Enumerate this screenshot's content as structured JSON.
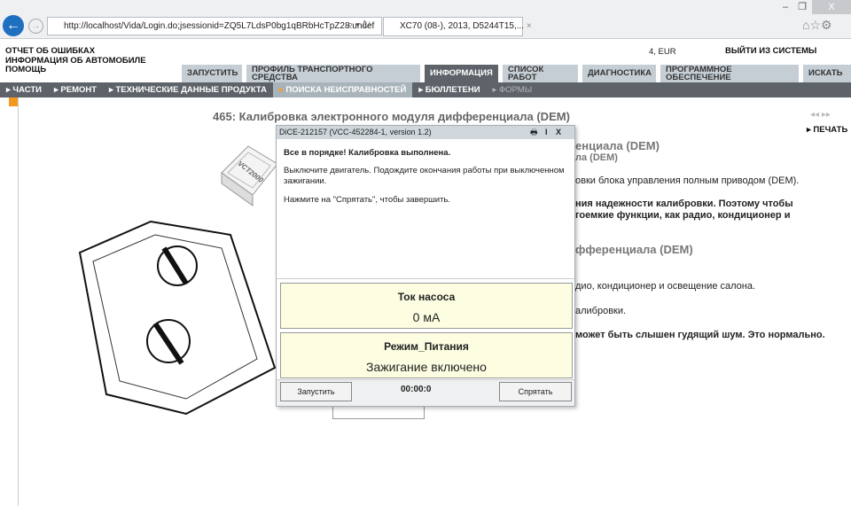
{
  "browser": {
    "url": "http://localhost/Vida/Login.do;jsessionid=ZQ5L7LdsP0bg1qBRbHcTpZ28.undef",
    "tab_title": "XC70 (08-), 2013, D5244T15,...",
    "tab_close": "×",
    "minimize": "–",
    "restore": "❐",
    "close": "X"
  },
  "header": {
    "links": [
      "ОТЧЕТ ОБ ОШИБКАХ",
      "ИНФОРМАЦИЯ ОБ АВТОМОБИЛЕ",
      "ПОМОЩЬ"
    ],
    "currency": "4, EUR",
    "logout": "ВЫЙТИ ИЗ СИСТЕМЫ"
  },
  "tabs": [
    "ЗАПУСТИТЬ",
    "ПРОФИЛЬ ТРАНСПОРТНОГО СРЕДСТВА",
    "ИНФОРМАЦИЯ",
    "СПИСОК РАБОТ",
    "ДИАГНОСТИКА",
    "ПРОГРАММНОЕ ОБЕСПЕЧЕНИЕ",
    "ИСКАТЬ"
  ],
  "subnav": [
    "ЧАСТИ",
    "РЕМОНТ",
    "ТЕХНИЧЕСКИЕ ДАННЫЕ ПРОДУКТА",
    "ПОИСКА НЕИСПРАВНОСТЕЙ",
    "БЮЛЛЕТЕНИ",
    "ФОРМЫ"
  ],
  "content": {
    "title": "465: Калибровка электронного модуля дифференциала (DEM)",
    "print": "ПЕЧАТЬ",
    "device_label": "VCT2000",
    "lines": [
      "енциала (DEM)",
      "ла (DEM)",
      "овки блока управления полным приводом (DEM).",
      "ния надежности калибровки. Поэтому чтобы",
      "гоемкие функции, как радио, кондиционер и",
      "фференциала (DEM)",
      "дио, кондиционер и освещение салона.",
      "алибровки.",
      "может быть слышен гудящий шум. Это нормально."
    ]
  },
  "dialog": {
    "title": "DiCE-212157   (VCC-452284-1, version 1.2)",
    "info_btn": "I",
    "close_btn": "X",
    "heading": "Все в порядке! Калибровка выполнена.",
    "text1": "Выключите двигатель. Подождите окончания работы при выключенном зажигании.",
    "text2": "Нажмите на \"Спрятать\", чтобы завершить.",
    "panels": [
      {
        "label": "Ток насоса",
        "value": "0 мА"
      },
      {
        "label": "Режим_Питания",
        "value": "Зажигание включено"
      }
    ],
    "start": "Запустить",
    "timer": "00:00:0",
    "hide": "Спрятать"
  }
}
